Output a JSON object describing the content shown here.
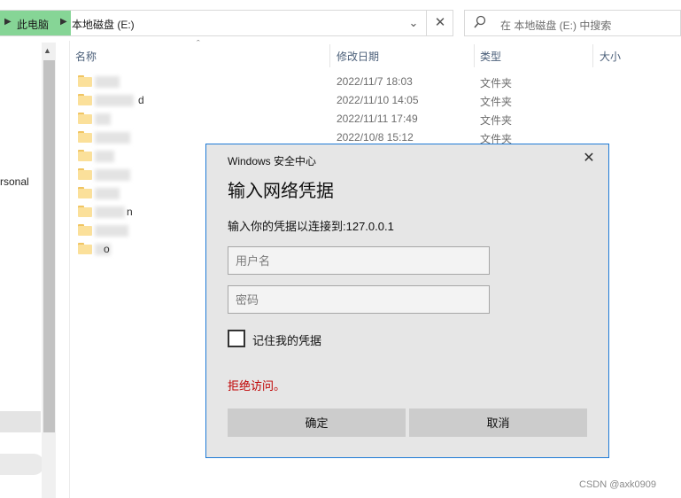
{
  "address_bar": {
    "crumbs": [
      "此电脑",
      "本地磁盘 (E:)"
    ],
    "dropdown_icon": "chevron-down-icon",
    "close_icon": "close-icon"
  },
  "search": {
    "placeholder": "在 本地磁盘 (E:) 中搜索",
    "icon": "search-icon"
  },
  "nav_pane": {
    "visible_text": "rsonal"
  },
  "file_list": {
    "columns": [
      "名称",
      "修改日期",
      "类型",
      "大小"
    ],
    "rows": [
      {
        "name_fragment": "",
        "date": "2022/11/7 18:03",
        "type": "文件夹"
      },
      {
        "name_fragment": "d",
        "date": "2022/11/10 14:05",
        "type": "文件夹"
      },
      {
        "name_fragment": "",
        "date": "2022/11/11 17:49",
        "type": "文件夹"
      },
      {
        "name_fragment": "",
        "date": "2022/10/8 15:12",
        "type": "文件夹"
      },
      {
        "name_fragment": "",
        "date": "",
        "type": ""
      },
      {
        "name_fragment": "",
        "date": "",
        "type": ""
      },
      {
        "name_fragment": "",
        "date": "",
        "type": ""
      },
      {
        "name_fragment": "n",
        "date": "",
        "type": ""
      },
      {
        "name_fragment": "",
        "date": "",
        "type": ""
      },
      {
        "name_fragment": "o",
        "date": "",
        "type": ""
      }
    ]
  },
  "dialog": {
    "caption": "Windows 安全中心",
    "title": "输入网络凭据",
    "prompt": "输入你的凭据以连接到:127.0.0.1",
    "username_placeholder": "用户名",
    "password_placeholder": "密码",
    "remember_label": "记住我的凭据",
    "remember_checked": false,
    "error": "拒绝访问。",
    "ok_label": "确定",
    "cancel_label": "取消",
    "close_icon": "close-icon",
    "accent_color": "#1e7ad6",
    "error_color": "#c00000"
  },
  "watermark": "CSDN @axk0909"
}
